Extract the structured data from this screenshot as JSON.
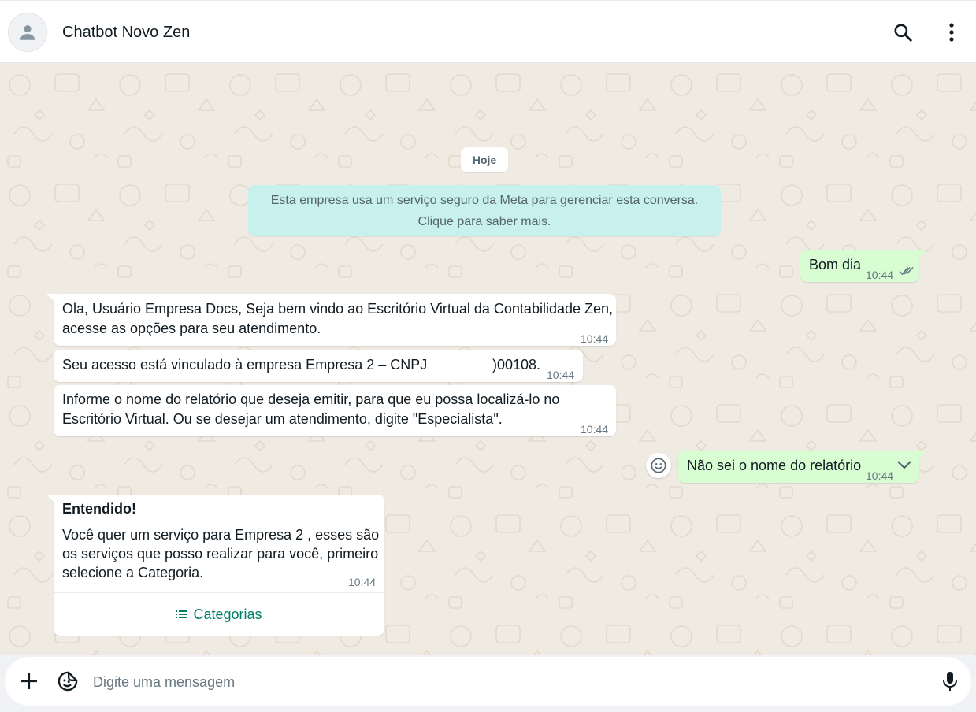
{
  "header": {
    "contact_name": "Chatbot Novo Zen",
    "icons": [
      "avatar-person-icon",
      "search-icon",
      "menu-dots-icon"
    ]
  },
  "chat": {
    "date_label": "Hoje",
    "system_notice": {
      "line1": "Esta empresa usa um serviço seguro da Meta para gerenciar esta conversa.",
      "line2": "Clique para saber mais."
    },
    "messages": [
      {
        "direction": "out",
        "text": "Bom dia",
        "time": "10:44",
        "status": "read"
      },
      {
        "direction": "in",
        "line1": "Ola, Usuário Empresa Docs, Seja bem vindo ao Escritório Virtual da Contabilidade Zen,",
        "line2": "acesse as opções para seu atendimento.",
        "time": "10:44"
      },
      {
        "direction": "in",
        "text_start": "Seu acesso está vinculado à empresa Empresa 2  – CNPJ",
        "text_end": ")00108.",
        "time": "10:44"
      },
      {
        "direction": "in",
        "line1": "Informe o nome do relatório que deseja emitir, para que eu possa localizá-lo no",
        "line2": "Escritório Virtual. Ou se desejar um atendimento, digite \"Especialista\".",
        "time": "10:44"
      },
      {
        "direction": "out",
        "text": "Não sei o nome do relatório",
        "time": "10:44",
        "status": "sent"
      },
      {
        "direction": "in",
        "title": "Entendido!",
        "line1": "Você quer um serviço para Empresa 2 , esses são",
        "line2": "os serviços que posso realizar para você, primeiro",
        "line3": "selecione a Categoria.",
        "time": "10:44",
        "button_label": "Categorias"
      }
    ]
  },
  "composer": {
    "placeholder": "Digite uma mensagem"
  },
  "colors": {
    "chat_bg": "#efeae2",
    "outgoing_bubble": "#d9fdd3",
    "incoming_bubble": "#ffffff",
    "system_bubble": "#c8f0ec",
    "accent_green": "#008069",
    "read_ticks": "#53bdeb"
  }
}
